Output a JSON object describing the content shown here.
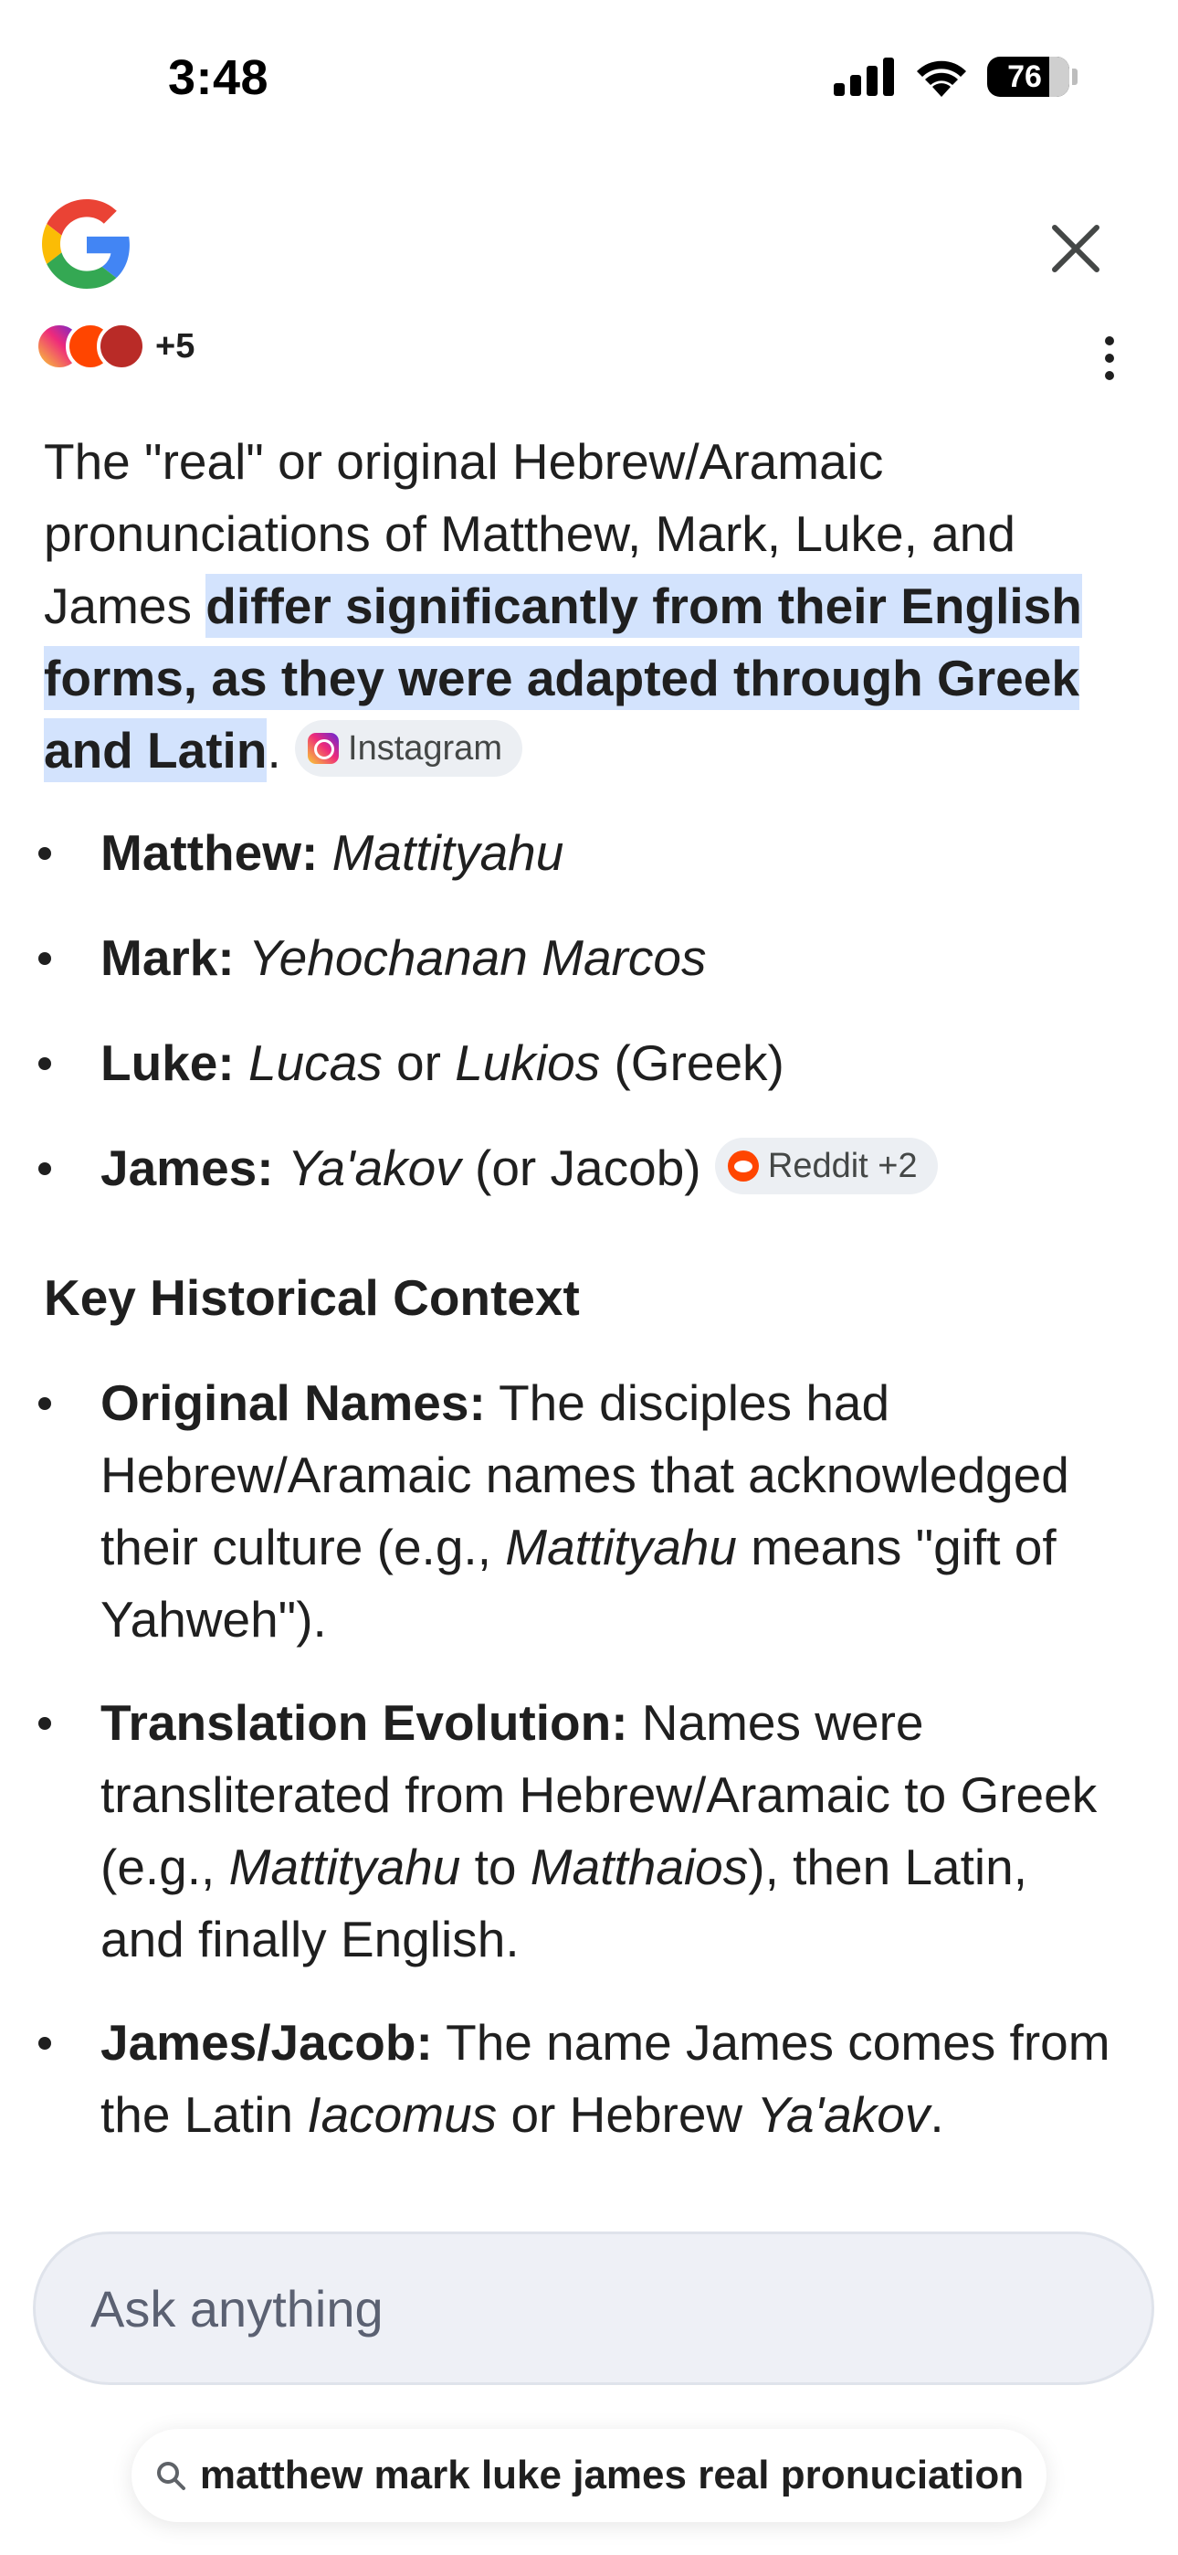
{
  "status_bar": {
    "time": "3:48",
    "battery": "76",
    "battery_level_percent": 76
  },
  "header": {
    "logo": "google-g-logo",
    "close_icon": "close-icon",
    "menu_icon": "more-vert-icon"
  },
  "sources_row": {
    "icons": [
      "instagram-icon",
      "reddit-icon",
      "quora-icon"
    ],
    "more_label": "+5"
  },
  "answer": {
    "intro_text": "The \"real\" or original Hebrew/Aramaic pronunciations of Matthew, Mark, Luke, and James ",
    "highlight_text": "differ significantly from their English forms, as they were adapted through Greek and Latin",
    "intro_end": ".",
    "intro_chip": "Instagram",
    "names": [
      {
        "label": "Matthew:",
        "value": "Mattityahu"
      },
      {
        "label": "Mark:",
        "value": "Yehochanan Marcos"
      },
      {
        "label": "Luke:",
        "value": "Lucas",
        "connector": " or ",
        "value2": "Lukios",
        "suffix": " (Greek)"
      },
      {
        "label": "James:",
        "value": "Ya'akov",
        "suffix": " (or Jacob)",
        "chip": "Reddit +2"
      }
    ],
    "section_heading": "Key Historical Context",
    "context": [
      {
        "label": "Original Names:",
        "text_a": " The disciples had Hebrew/Aramaic names that acknowledged their culture (e.g., ",
        "em_a": "Mattityahu",
        "text_b": " means \"gift of Yahweh\")."
      },
      {
        "label": "Translation Evolution:",
        "text_a": " Names were transliterated from Hebrew/Aramaic to Greek (e.g., ",
        "em_a": "Mattityahu",
        "text_b": " to ",
        "em_b": "Matthaios",
        "text_c": "), then Latin, and finally English."
      },
      {
        "label": "James/Jacob:",
        "text_a": " The name James comes from the Latin ",
        "em_a": "Iacomus",
        "text_b": " or Hebrew ",
        "em_b": "Ya'akov",
        "text_c": "."
      }
    ]
  },
  "input": {
    "placeholder": "Ask anything"
  },
  "query": {
    "text": "matthew mark luke james real pronuciation",
    "icon": "search-icon"
  }
}
